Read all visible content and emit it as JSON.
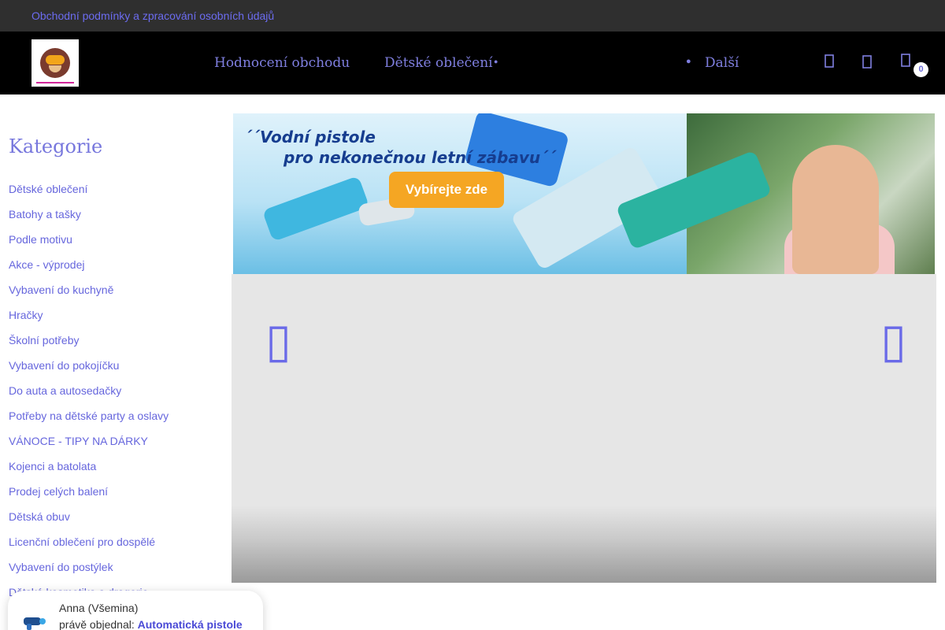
{
  "topbar": {
    "terms_link": "Obchodní podmínky a zpracování osobních údajů"
  },
  "header": {
    "nav": [
      {
        "label": "Hodnocení obchodu"
      },
      {
        "label": "Dětské oblečení"
      }
    ],
    "more_label": "Další",
    "cart_count": "0",
    "icons": [
      "search-icon",
      "user-icon",
      "cart-icon"
    ]
  },
  "sidebar": {
    "title": "Kategorie",
    "items": [
      {
        "label": "Dětské oblečení"
      },
      {
        "label": "Batohy a tašky"
      },
      {
        "label": "Podle motivu"
      },
      {
        "label": "Akce - výprodej"
      },
      {
        "label": "Vybavení do kuchyně"
      },
      {
        "label": "Hračky"
      },
      {
        "label": "Školní potřeby"
      },
      {
        "label": "Vybavení do pokojíčku"
      },
      {
        "label": "Do auta a autosedačky"
      },
      {
        "label": "Potřeby na dětské party a oslavy"
      },
      {
        "label": "VÁNOCE - TIPY NA DÁRKY"
      },
      {
        "label": "Kojenci a batolata"
      },
      {
        "label": "Prodej celých balení"
      },
      {
        "label": "Dětská obuv"
      },
      {
        "label": "Licenční oblečení pro dospělé"
      },
      {
        "label": "Vybavení do postýlek"
      },
      {
        "label": "Dětská kosmetika a drogerie"
      }
    ]
  },
  "banner": {
    "line1": "´´Vodní pistole",
    "line2": "pro nekonečnou letní zábavu´´",
    "cta": "Vybírejte zde"
  },
  "popup": {
    "name": "Anna (Všemina)",
    "prefix": "právě objednal:",
    "product": "Automatická pistole"
  },
  "colors": {
    "accent": "#6c6cf0",
    "topbar_bg": "#2f2f2f",
    "header_bg": "#000000",
    "cta": "#f5a623"
  }
}
